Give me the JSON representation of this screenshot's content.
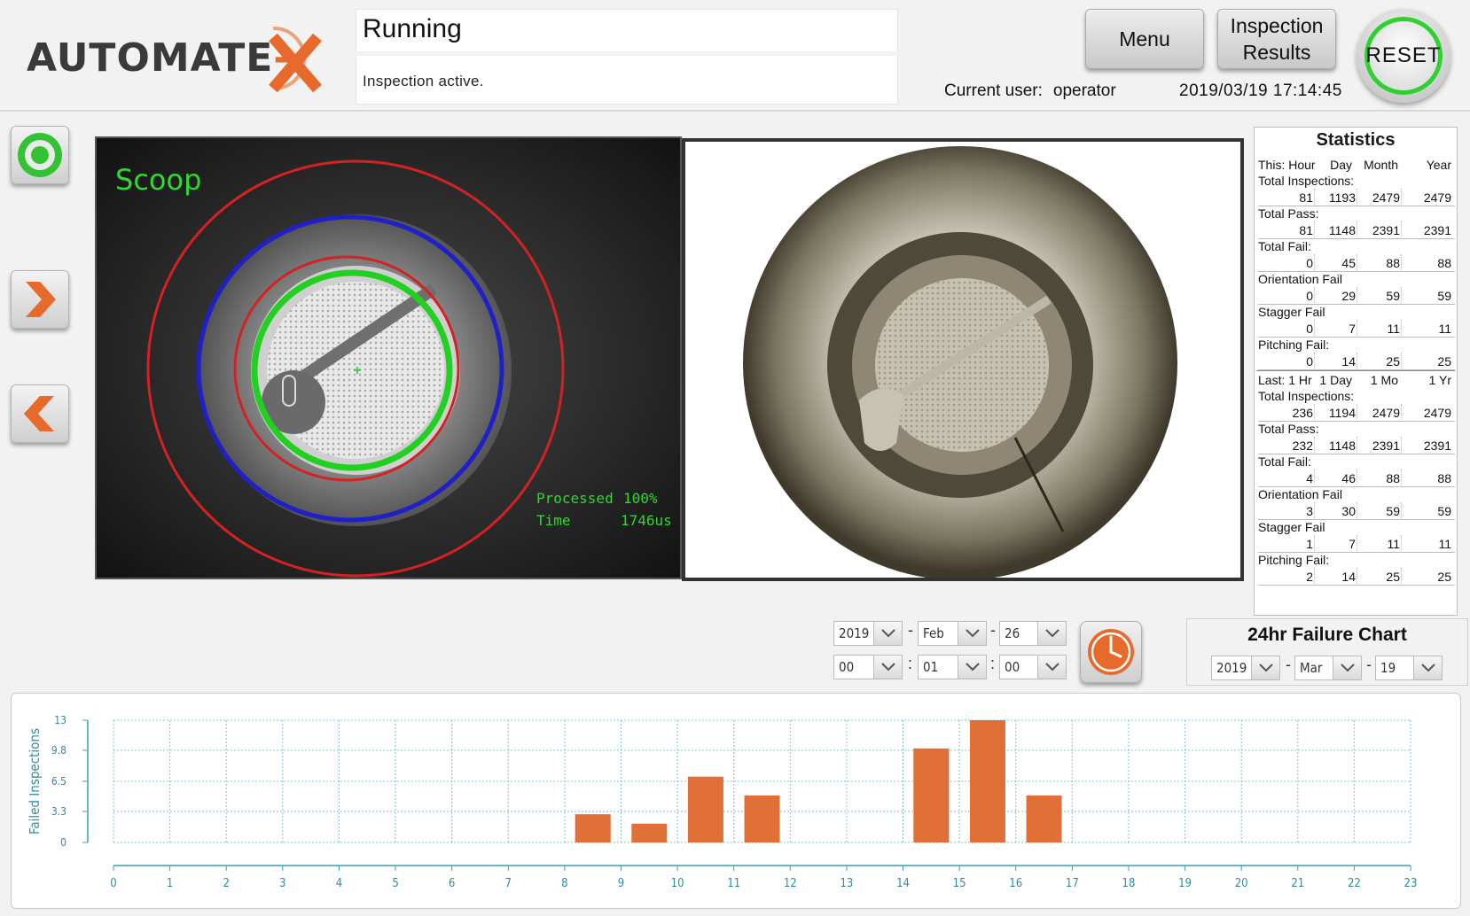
{
  "brand": {
    "name_left": "AUTOMATE",
    "name_dash": "-",
    "name_right": "X",
    "accent": "#e76a2c"
  },
  "status": {
    "title": "Running",
    "message": "Inspection active."
  },
  "header": {
    "menu_label": "Menu",
    "results_label": "Inspection Results",
    "reset_label": "RESET",
    "user_label": "Current user:",
    "user_name": "operator",
    "datetime": "2019/03/19  17:14:45"
  },
  "side_buttons": [
    {
      "name": "start",
      "icon": "record-icon"
    },
    {
      "name": "next",
      "icon": "chevron-right-icon"
    },
    {
      "name": "previous",
      "icon": "chevron-left-icon"
    }
  ],
  "camera": {
    "label": "Scoop",
    "processed_label": "Processed",
    "processed_value": "100%",
    "time_label": "Time",
    "time_value": "1746us"
  },
  "statistics": {
    "title": "Statistics",
    "current": {
      "header": [
        "This: Hour",
        "Day",
        "Month",
        "Year"
      ],
      "rows": [
        {
          "label": "Total Inspections:",
          "values": [
            "81",
            "1193",
            "2479",
            "2479"
          ]
        },
        {
          "label": "Total Pass:",
          "values": [
            "81",
            "1148",
            "2391",
            "2391"
          ]
        },
        {
          "label": "Total Fail:",
          "values": [
            "0",
            "45",
            "88",
            "88"
          ]
        },
        {
          "label": "Orientation Fail",
          "values": [
            "0",
            "29",
            "59",
            "59"
          ]
        },
        {
          "label": "Stagger Fail",
          "values": [
            "0",
            "7",
            "11",
            "11"
          ]
        },
        {
          "label": "Pitching Fail:",
          "values": [
            "0",
            "14",
            "25",
            "25"
          ]
        }
      ]
    },
    "rolling": {
      "header": [
        "Last: 1 Hr",
        "1 Day",
        "1 Mo",
        "1 Yr"
      ],
      "rows": [
        {
          "label": "Total Inspections:",
          "values": [
            "236",
            "1194",
            "2479",
            "2479"
          ]
        },
        {
          "label": "Total Pass:",
          "values": [
            "232",
            "1148",
            "2391",
            "2391"
          ]
        },
        {
          "label": "Total Fail:",
          "values": [
            "4",
            "46",
            "88",
            "88"
          ]
        },
        {
          "label": "Orientation Fail",
          "values": [
            "3",
            "30",
            "59",
            "59"
          ]
        },
        {
          "label": "Stagger Fail",
          "values": [
            "1",
            "7",
            "11",
            "11"
          ]
        },
        {
          "label": "Pitching Fail:",
          "values": [
            "2",
            "14",
            "25",
            "25"
          ]
        }
      ]
    }
  },
  "range_selector": {
    "year": "2019",
    "month": "Feb",
    "day": "26",
    "hour": "00",
    "minute": "01",
    "second": "00",
    "date_sep": "-",
    "time_sep": ":"
  },
  "failure_chart": {
    "title": "24hr Failure Chart",
    "year": "2019",
    "month": "Mar",
    "day": "19"
  },
  "chart_data": {
    "type": "bar",
    "ylabel": "Failed Inspections",
    "xlabel": "",
    "ylim": [
      0,
      13
    ],
    "yticks": [
      "0",
      "3.3",
      "6.5",
      "9.8",
      "13"
    ],
    "categories": [
      "0",
      "1",
      "2",
      "3",
      "4",
      "5",
      "6",
      "7",
      "8",
      "9",
      "10",
      "11",
      "12",
      "13",
      "14",
      "15",
      "16",
      "17",
      "18",
      "19",
      "20",
      "21",
      "22",
      "23"
    ],
    "values": [
      0,
      0,
      0,
      0,
      0,
      0,
      0,
      0,
      3,
      2,
      7,
      5,
      0,
      0,
      10,
      13,
      5,
      0,
      0,
      0,
      0,
      0,
      0,
      0
    ],
    "bar_color": "#e07038",
    "grid": true
  }
}
